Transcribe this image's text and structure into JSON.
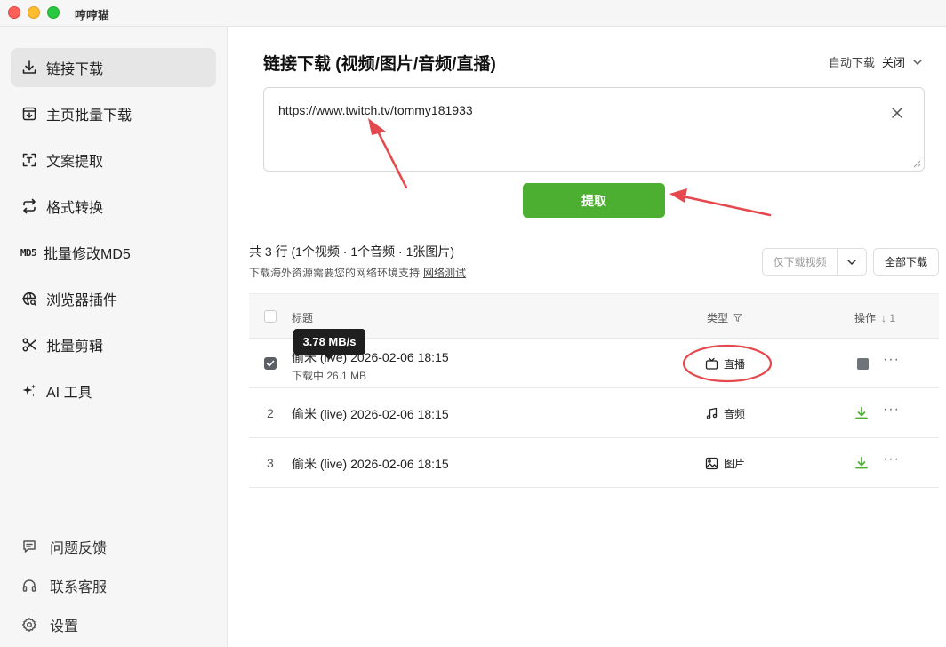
{
  "app": {
    "title": "哼哼猫"
  },
  "sidebar": {
    "items": [
      {
        "label": "链接下载",
        "icon": "download-icon",
        "active": true
      },
      {
        "label": "主页批量下载",
        "icon": "inbox-download-icon"
      },
      {
        "label": "文案提取",
        "icon": "text-scan-icon"
      },
      {
        "label": "格式转换",
        "icon": "convert-arrows-icon"
      },
      {
        "label": "批量修改MD5",
        "icon": "md5-icon",
        "icon_text": "MD5"
      },
      {
        "label": "浏览器插件",
        "icon": "globe-search-icon"
      },
      {
        "label": "批量剪辑",
        "icon": "scissors-icon"
      },
      {
        "label": "AI 工具",
        "icon": "sparkle-icon"
      }
    ],
    "bottom": [
      {
        "label": "问题反馈",
        "icon": "feedback-icon"
      },
      {
        "label": "联系客服",
        "icon": "headset-icon"
      },
      {
        "label": "设置",
        "icon": "gear-icon"
      }
    ]
  },
  "main": {
    "title": "链接下载 (视频/图片/音频/直播)",
    "auto_download_label": "自动下载",
    "auto_download_value": "关闭",
    "url_value": "https://www.twitch.tv/tommy181933",
    "extract_label": "提取",
    "summary": "共 3 行 (1个视频 · 1个音频 · 1张图片)",
    "hint": "下载海外资源需要您的网络环境支持",
    "hint_link": "网络测试",
    "filter_label": "仅下载视频",
    "download_all_label": "全部下载",
    "table": {
      "col_title": "标题",
      "col_type": "类型",
      "col_op": "操作",
      "sort_indicator": "↓ 1",
      "rows": [
        {
          "num": "",
          "title": "偷米 (live) 2026-02-06 18:15",
          "sub": "下载中 26.1 MB",
          "type": "直播",
          "type_icon": "tv-icon",
          "checked": true,
          "op": "stop"
        },
        {
          "num": "2",
          "title": "偷米 (live) 2026-02-06 18:15",
          "sub": "",
          "type": "音频",
          "type_icon": "music-icon",
          "op": "download"
        },
        {
          "num": "3",
          "title": "偷米 (live) 2026-02-06 18:15",
          "sub": "",
          "type": "图片",
          "type_icon": "image-icon",
          "op": "download"
        }
      ]
    },
    "tooltip_speed": "3.78 MB/s",
    "more_glyph": "···"
  },
  "colors": {
    "accent_green": "#4caf32",
    "annotation_red": "#e5484d"
  }
}
